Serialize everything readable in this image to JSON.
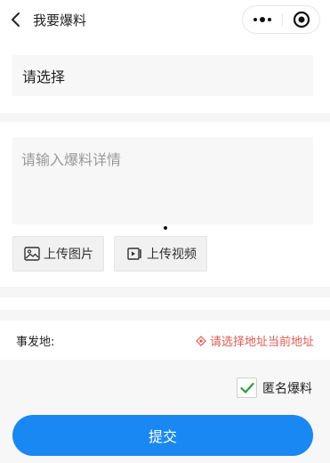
{
  "nav": {
    "title": "我要爆料",
    "back_icon": "chevron-left-icon",
    "more_icon": "more-dots-icon",
    "close_icon": "target-circle-icon"
  },
  "form": {
    "select_label": "请选择",
    "detail_placeholder": "请输入爆料详情",
    "upload_image_label": "上传图片",
    "upload_video_label": "上传视频",
    "location_label": "事发地:",
    "location_action": "请选择地址当前地址",
    "anonymous_label": "匿名爆料",
    "anonymous_checked": true,
    "submit_label": "提交"
  },
  "colors": {
    "accent": "#1a88f2",
    "location_link": "#e05a4f",
    "check": "#27a03b"
  }
}
